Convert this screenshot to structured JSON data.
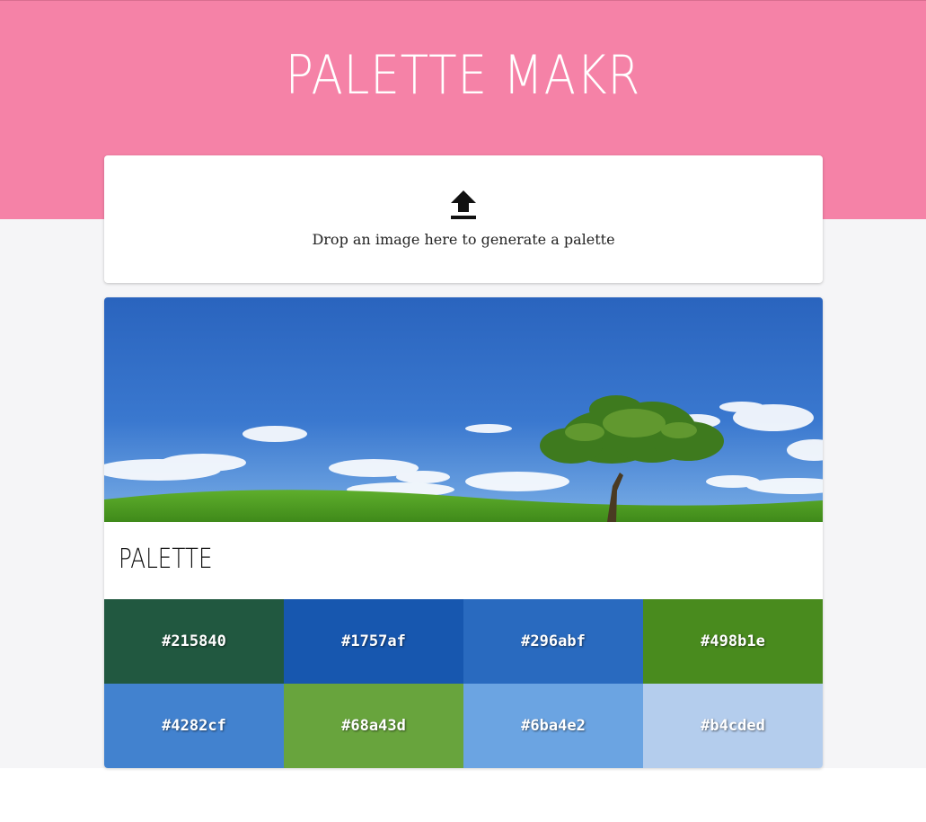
{
  "header": {
    "title": "PALETTE MAKR",
    "background": "#f582a7"
  },
  "dropzone": {
    "icon": "upload-icon",
    "text": "Drop an image here to generate a palette"
  },
  "result": {
    "image": "landscape-photo-tree-on-hill",
    "heading": "PALETTE",
    "swatches": [
      {
        "hex": "#215840",
        "label": "#215840"
      },
      {
        "hex": "#1757af",
        "label": "#1757af"
      },
      {
        "hex": "#296abf",
        "label": "#296abf"
      },
      {
        "hex": "#498b1e",
        "label": "#498b1e"
      },
      {
        "hex": "#4282cf",
        "label": "#4282cf"
      },
      {
        "hex": "#68a43d",
        "label": "#68a43d"
      },
      {
        "hex": "#6ba4e2",
        "label": "#6ba4e2"
      },
      {
        "hex": "#b4cded",
        "label": "#b4cded"
      }
    ]
  }
}
